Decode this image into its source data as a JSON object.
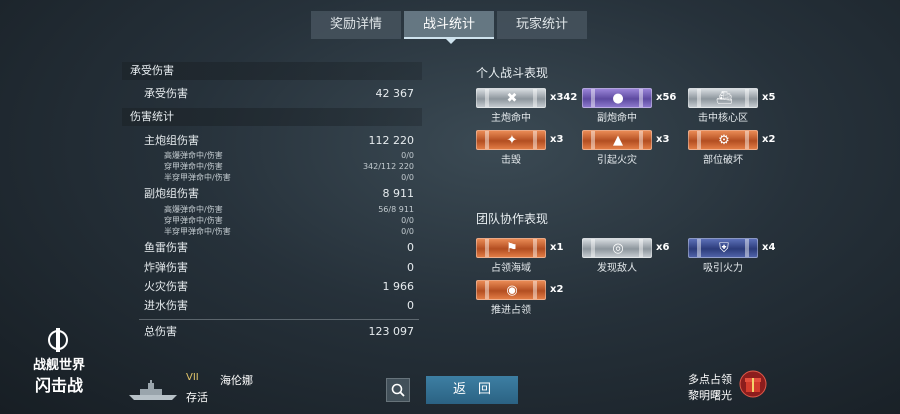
{
  "tabs": [
    {
      "label": "奖励详情",
      "active": false
    },
    {
      "label": "战斗统计",
      "active": true
    },
    {
      "label": "玩家统计",
      "active": false
    }
  ],
  "left": {
    "received": {
      "header": "承受伤害",
      "row": {
        "label": "承受伤害",
        "value": "42 367"
      }
    },
    "damage": {
      "header": "伤害统计",
      "main_battery": {
        "label": "主炮组伤害",
        "value": "112 220"
      },
      "main_sub": [
        {
          "label": "高爆弹命中/伤害",
          "value": "0/0"
        },
        {
          "label": "穿甲弹命中/伤害",
          "value": "342/112 220"
        },
        {
          "label": "半穿甲弹命中/伤害",
          "value": "0/0"
        }
      ],
      "secondary": {
        "label": "副炮组伤害",
        "value": "8 911"
      },
      "secondary_sub": [
        {
          "label": "高爆弹命中/伤害",
          "value": "56/8 911"
        },
        {
          "label": "穿甲弹命中/伤害",
          "value": "0/0"
        },
        {
          "label": "半穿甲弹命中/伤害",
          "value": "0/0"
        }
      ],
      "others": [
        {
          "label": "鱼雷伤害",
          "value": "0"
        },
        {
          "label": "炸弹伤害",
          "value": "0"
        },
        {
          "label": "火灾伤害",
          "value": "1 966"
        },
        {
          "label": "进水伤害",
          "value": "0"
        }
      ],
      "total": {
        "label": "总伤害",
        "value": "123 097"
      }
    }
  },
  "right": {
    "personal_header": "个人战斗表现",
    "personal": [
      {
        "label": "主炮命中",
        "count": "x342",
        "color": "silver",
        "icon": "shell-icon"
      },
      {
        "label": "副炮命中",
        "count": "x56",
        "color": "purple",
        "icon": "secondary-shell-icon"
      },
      {
        "label": "击中核心区",
        "count": "x5",
        "color": "silver",
        "icon": "citadel-ship-icon"
      },
      {
        "label": "击毁",
        "count": "x3",
        "color": "orange",
        "icon": "destroyed-icon"
      },
      {
        "label": "引起火灾",
        "count": "x3",
        "color": "orange",
        "icon": "fire-icon"
      },
      {
        "label": "部位破坏",
        "count": "x2",
        "color": "orange",
        "icon": "module-damage-icon"
      }
    ],
    "team_header": "团队协作表现",
    "team": [
      {
        "label": "占领海域",
        "count": "x1",
        "color": "orange",
        "icon": "flag-icon"
      },
      {
        "label": "发现敌人",
        "count": "x6",
        "color": "silver",
        "icon": "spotting-icon"
      },
      {
        "label": "吸引火力",
        "count": "x4",
        "color": "darkblue",
        "icon": "tank-damage-icon"
      },
      {
        "label": "推进占领",
        "count": "x2",
        "color": "orange",
        "icon": "capture-assist-icon"
      }
    ]
  },
  "bottom": {
    "logo_line1": "战舰世界",
    "logo_line2": "闪击战",
    "tier": "VII",
    "ship_name": "海伦娜",
    "status": "存活",
    "back_label": "返回",
    "mode_line1": "多点占领",
    "mode_line2": "黎明曙光"
  },
  "colors": {
    "accent": "#2b6283",
    "active_tab": "#687a86",
    "medal_silver": "#a7afb5",
    "medal_purple": "#6a56b0",
    "medal_orange": "#c85c2a",
    "medal_blue": "#34468a"
  }
}
